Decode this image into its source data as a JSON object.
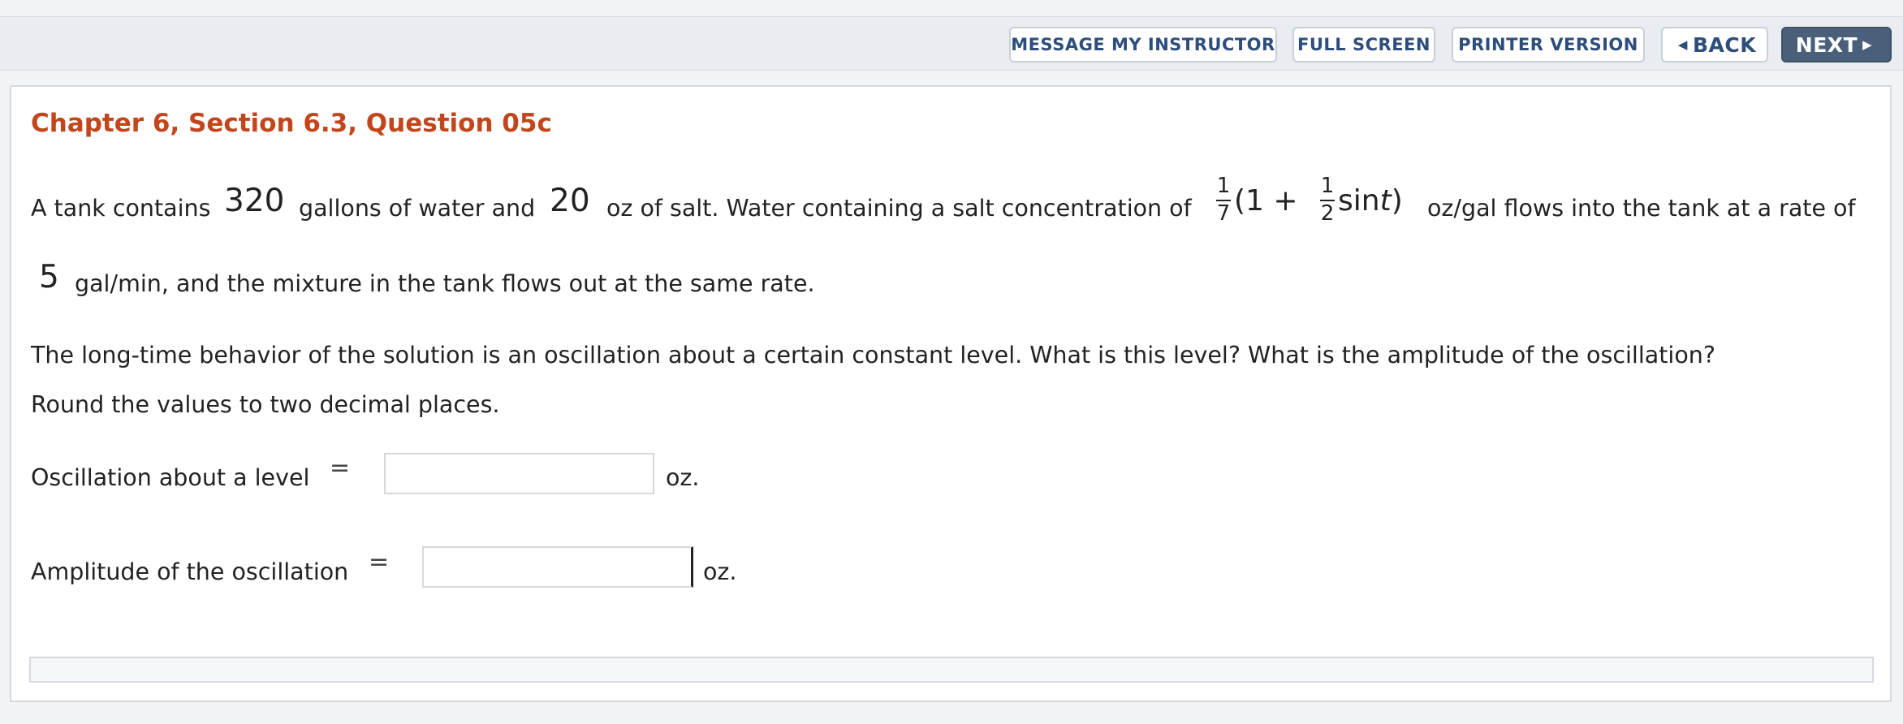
{
  "toolbar": {
    "message_label": "MESSAGE MY INSTRUCTOR",
    "fullscreen_label": "FULL SCREEN",
    "printer_label": "PRINTER VERSION",
    "back_label": "BACK",
    "next_label": "NEXT",
    "back_icon": "triangle-left-icon",
    "next_icon": "triangle-right-icon"
  },
  "question": {
    "title": "Chapter 6, Section 6.3, Question 05c",
    "line1_part1": "A tank contains",
    "volume": "320",
    "line1_part2": "gallons of water and",
    "salt": "20",
    "line1_part3": "oz of salt. Water containing a salt concentration of",
    "concentration": {
      "outer_num": "1",
      "outer_den": "7",
      "open": "(1 +",
      "inner_num": "1",
      "inner_den": "2",
      "func": "sin",
      "var": "t",
      "close": ")"
    },
    "line1_part4": "oz/gal flows into the tank at a rate of",
    "rate": "5",
    "line2": "gal/min, and the mixture in the tank flows out at the same rate.",
    "line3": "The long-time behavior of the solution is an oscillation about a certain constant level. What is this level? What is the amplitude of the oscillation?",
    "line4": "Round the values to two decimal places."
  },
  "answers": {
    "level_label": "Oscillation about a level",
    "level_value": "",
    "level_unit": "oz.",
    "amplitude_label": "Amplitude of the oscillation",
    "amplitude_value": "",
    "amplitude_unit": "oz.",
    "equals": "="
  },
  "colors": {
    "title": "#c2461b",
    "button_text": "#2d4d7d",
    "next_bg": "#4a5f79"
  }
}
